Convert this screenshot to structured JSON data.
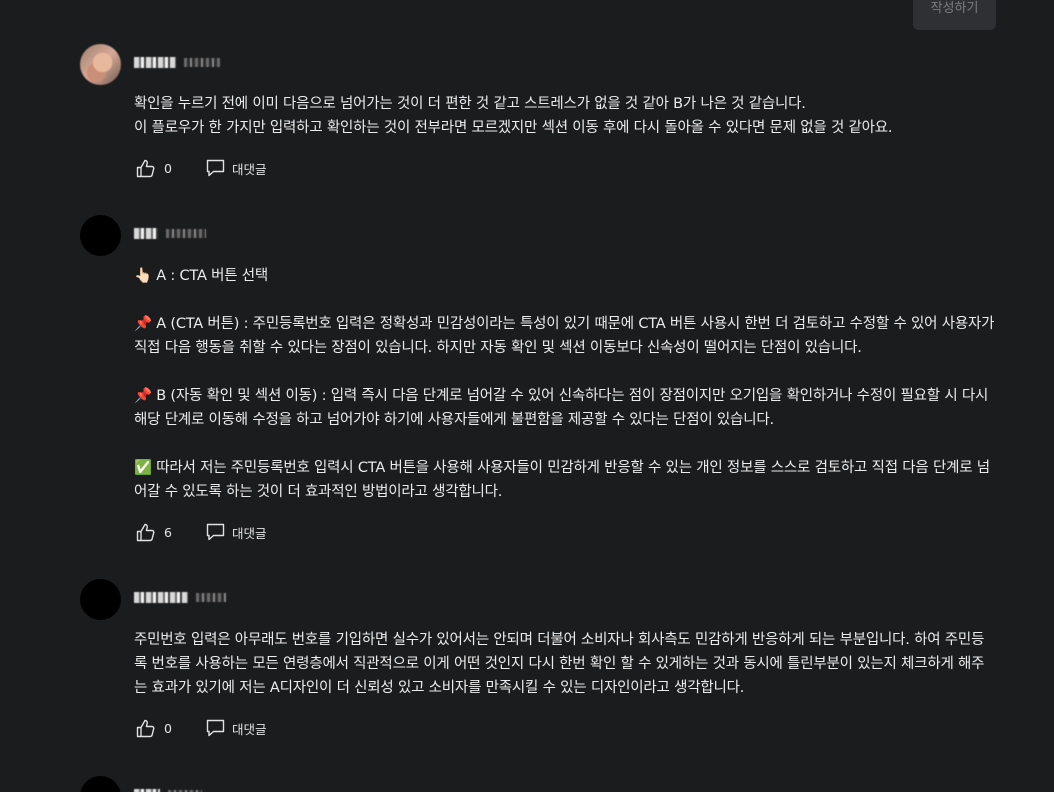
{
  "toolbar": {
    "submit_label": "작성하기"
  },
  "actions": {
    "reply_label": "대댓글"
  },
  "comments": [
    {
      "lines": [
        "확인을 누르기 전에 이미 다음으로 넘어가는 것이 더 편한 것 같고 스트레스가 없을 것 같아 B가 나은 것 같습니다.",
        "이 플로우가 한 가지만 입력하고 확인하는 것이 전부라면 모르겠지만 섹션 이동 후에 다시 돌아올 수 있다면 문제 없을 것 같아요."
      ],
      "likes": "0"
    },
    {
      "paragraphs": [
        "👆🏻 A : CTA 버튼 선택",
        "📌 A (CTA 버튼) : 주민등록번호 입력은 정확성과 민감성이라는 특성이 있기 때문에 CTA 버튼 사용시 한번 더 검토하고 수정할 수 있어 사용자가 직접 다음 행동을 취할 수 있다는 장점이 있습니다. 하지만 자동 확인 및 섹션 이동보다 신속성이 떨어지는 단점이 있습니다.",
        "📌 B (자동 확인 및 섹션 이동) : 입력 즉시 다음 단계로 넘어갈 수 있어 신속하다는 점이 장점이지만 오기입을 확인하거나 수정이 필요할 시 다시 해당 단계로 이동해 수정을 하고 넘어가야 하기에 사용자들에게 불편함을 제공할 수 있다는 단점이 있습니다.",
        "✅ 따라서 저는 주민등록번호 입력시 CTA 버튼을 사용해 사용자들이 민감하게 반응할 수 있는 개인 정보를 스스로 검토하고 직접 다음 단계로 넘어갈 수 있도록 하는 것이 더 효과적인 방법이라고 생각합니다."
      ],
      "likes": "6"
    },
    {
      "lines": [
        "주민번호 입력은 아무래도 번호를 기입하면 실수가 있어서는 안되며 더불어 소비자나 회사측도 민감하게 반응하게 되는 부분입니다. 하여 주민등록 번호를 사용하는 모든 연령층에서 직관적으로 이게 어떤 것인지 다시 한번 확인 할 수 있게하는 것과 동시에 틀린부분이 있는지 체크하게 해주는 효과가 있기에 저는 A디자인이 더 신뢰성 있고 소비자를 만족시킬 수 있는 디자인이라고 생각합니다."
      ],
      "likes": "0"
    }
  ]
}
